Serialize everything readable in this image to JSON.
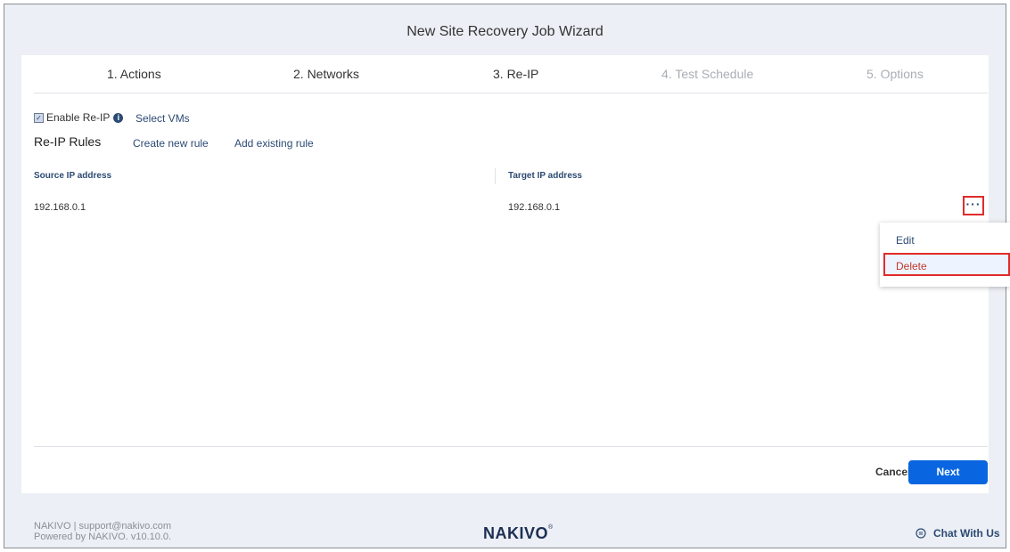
{
  "window": {
    "title": "New Site Recovery Job Wizard"
  },
  "steps": [
    {
      "label": "1. Actions",
      "state": "done"
    },
    {
      "label": "2. Networks",
      "state": "done"
    },
    {
      "label": "3. Re-IP",
      "state": "active"
    },
    {
      "label": "4. Test Schedule",
      "state": "disabled"
    },
    {
      "label": "5. Options",
      "state": "disabled"
    }
  ],
  "reip": {
    "enable_label": "Enable Re-IP",
    "enabled": true,
    "select_vms": "Select VMs",
    "rules_title": "Re-IP Rules",
    "create_rule": "Create new rule",
    "add_rule": "Add existing rule"
  },
  "table": {
    "columns": [
      "Source IP address",
      "Target IP address"
    ],
    "rows": [
      {
        "source": "192.168.0.1",
        "target": "192.168.0.1"
      }
    ]
  },
  "row_menu": {
    "trigger": "···",
    "items": [
      "Edit",
      "Delete"
    ]
  },
  "buttons": {
    "cancel": "Cancel",
    "next": "Next"
  },
  "footer": {
    "line1": "NAKIVO | support@nakivo.com",
    "line2": "Powered by NAKIVO. v10.10.0.",
    "logo": "NAKIVO",
    "logo_mark": "®",
    "chat": "Chat With Us"
  },
  "colors": {
    "accent": "#0a66e0",
    "link": "#2c4a73",
    "highlight": "#e02b2b",
    "background": "#eceff5"
  }
}
